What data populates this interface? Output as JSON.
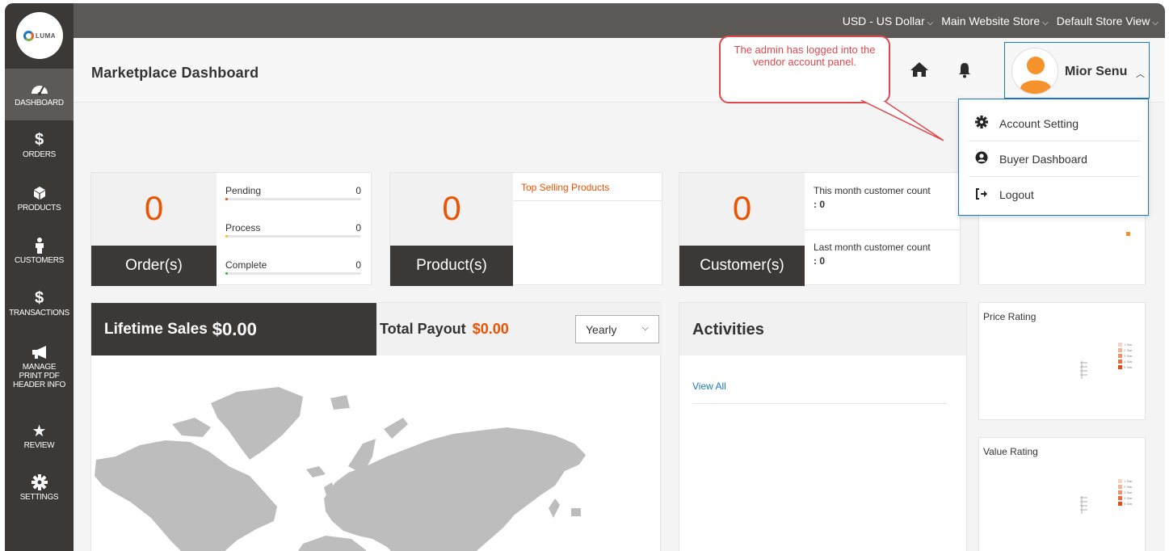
{
  "sidebar": {
    "logo_text": "LUMA",
    "items": [
      {
        "label": "DASHBOARD",
        "icon": "speedometer-icon",
        "active": true
      },
      {
        "label": "ORDERS",
        "icon": "dollar-icon"
      },
      {
        "label": "PRODUCTS",
        "icon": "cube-icon"
      },
      {
        "label": "CUSTOMERS",
        "icon": "person-icon"
      },
      {
        "label": "TRANSACTIONS",
        "icon": "dollar-icon"
      },
      {
        "label": "MANAGE PRINT PDF HEADER INFO",
        "icon": "megaphone-icon"
      },
      {
        "label": "REVIEW",
        "icon": "star-icon"
      },
      {
        "label": "SETTINGS",
        "icon": "gear-icon"
      }
    ]
  },
  "topbar": {
    "currency": "USD - US Dollar",
    "website": "Main Website Store",
    "store_view": "Default Store View"
  },
  "header": {
    "title": "Marketplace Dashboard",
    "user_name": "Mior Senu"
  },
  "callout": {
    "text": "The admin has logged into the vendor account panel."
  },
  "dropdown": {
    "items": [
      {
        "label": "Account Setting",
        "icon": "gear-icon"
      },
      {
        "label": "Buyer Dashboard",
        "icon": "user-circle-icon"
      },
      {
        "label": "Logout",
        "icon": "logout-icon"
      }
    ]
  },
  "orders_card": {
    "count": "0",
    "label": "Order(s)",
    "stats": [
      {
        "label": "Pending",
        "value": "0",
        "color": "#eb5202"
      },
      {
        "label": "Process",
        "value": "0",
        "color": "#f1c40f"
      },
      {
        "label": "Complete",
        "value": "0",
        "color": "#2eb82e"
      }
    ]
  },
  "products_card": {
    "count": "0",
    "label": "Product(s)",
    "top_selling_label": "Top Selling Products"
  },
  "customers_card": {
    "count": "0",
    "label": "Customer(s)",
    "this_month_label": "This month customer count",
    "this_month_value": ": 0",
    "last_month_label": "Last month customer count",
    "last_month_value": ": 0"
  },
  "sales": {
    "lifetime_label": "Lifetime Sales",
    "lifetime_value": "$0.00",
    "payout_label": "Total Payout",
    "payout_value": "$0.00",
    "period": "Yearly"
  },
  "activities": {
    "title": "Activities",
    "view_all": "View All"
  },
  "ratings": {
    "price_title": "Price Rating",
    "value_title": "Value Rating",
    "legend": [
      "1 Star",
      "2 Star",
      "3 Star",
      "4 Star",
      "5 Star"
    ],
    "legend_colors": [
      "#f7d3c2",
      "#f4b196",
      "#f08f6a",
      "#ec6d3e",
      "#e54b12"
    ]
  },
  "colors": {
    "accent": "#eb5202",
    "dark": "#3b3836",
    "link": "#1979c3",
    "callout": "#e0484d"
  }
}
